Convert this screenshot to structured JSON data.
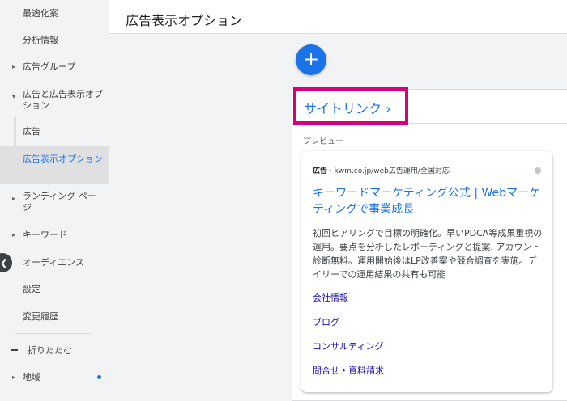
{
  "sidebar": {
    "items": [
      {
        "label": "最適化案",
        "caret": false
      },
      {
        "label": "分析情報",
        "caret": false
      },
      {
        "label": "広告グループ",
        "caret": "▸"
      },
      {
        "label": "広告と広告表示オプション",
        "caret": "▾"
      },
      {
        "label": "広告",
        "caret": false
      },
      {
        "label": "広告表示オプション",
        "caret": false,
        "active": true
      },
      {
        "label": "ランディング ページ",
        "caret": "▸"
      },
      {
        "label": "キーワード",
        "caret": "▸"
      },
      {
        "label": "オーディエンス",
        "caret": false
      },
      {
        "label": "設定",
        "caret": false
      },
      {
        "label": "変更履歴",
        "caret": false
      },
      {
        "label": "折りたたむ",
        "caret": false
      },
      {
        "label": "地域",
        "caret": "▸"
      }
    ]
  },
  "header": {
    "title": "広告表示オプション"
  },
  "fab": {
    "label": "+"
  },
  "sitelink": {
    "title": "サイトリンク ›"
  },
  "preview": {
    "label": "プレビュー",
    "ad": {
      "badge": "広告",
      "url": " · kwm.co.jp/web広告運用/全国対応",
      "headline": "キーワードマーケティング公式 | Webマーケティングで事業成長",
      "description": "初回ヒアリングで目標の明確化。早いPDCA等成果重視の運用。要点を分析したレポーティングと提案. アカウント診断無料。運用開始後はLP改善案や競合調査を実施。デイリーでの運用結果の共有も可能",
      "sitelinks": [
        "会社情報",
        "ブログ",
        "コンサルティング",
        "問合せ・資料請求"
      ]
    }
  },
  "colors": {
    "accent": "#1a73e8",
    "highlight": "#d5007d"
  }
}
